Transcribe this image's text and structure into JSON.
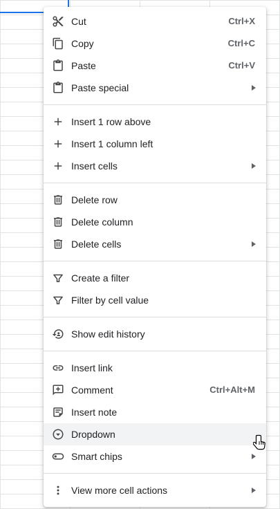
{
  "menu": {
    "groups": [
      [
        {
          "label": "Cut",
          "shortcut": "Ctrl+X",
          "icon": "scissors-icon"
        },
        {
          "label": "Copy",
          "shortcut": "Ctrl+C",
          "icon": "copy-icon"
        },
        {
          "label": "Paste",
          "shortcut": "Ctrl+V",
          "icon": "clipboard-icon"
        },
        {
          "label": "Paste special",
          "icon": "clipboard-icon",
          "submenu": true
        }
      ],
      [
        {
          "label": "Insert 1 row above",
          "icon": "plus-icon"
        },
        {
          "label": "Insert 1 column left",
          "icon": "plus-icon"
        },
        {
          "label": "Insert cells",
          "icon": "plus-icon",
          "submenu": true
        }
      ],
      [
        {
          "label": "Delete row",
          "icon": "trash-icon"
        },
        {
          "label": "Delete column",
          "icon": "trash-icon"
        },
        {
          "label": "Delete cells",
          "icon": "trash-icon",
          "submenu": true
        }
      ],
      [
        {
          "label": "Create a filter",
          "icon": "filter-icon"
        },
        {
          "label": "Filter by cell value",
          "icon": "filter-icon"
        }
      ],
      [
        {
          "label": "Show edit history",
          "icon": "history-icon"
        }
      ],
      [
        {
          "label": "Insert link",
          "icon": "link-icon"
        },
        {
          "label": "Comment",
          "shortcut": "Ctrl+Alt+M",
          "icon": "add-comment-icon"
        },
        {
          "label": "Insert note",
          "icon": "note-icon"
        },
        {
          "label": "Dropdown",
          "icon": "dropdown-circle-icon",
          "hovered": true
        },
        {
          "label": "Smart chips",
          "icon": "smart-chips-icon",
          "submenu": true
        }
      ],
      [
        {
          "label": "View more cell actions",
          "icon": "more-vert-icon",
          "submenu": true
        }
      ]
    ]
  },
  "colors": {
    "icon": "#444746",
    "text": "#202124",
    "shortcut": "#5f6368",
    "hover_bg": "#f1f3f4",
    "selection": "#1a73e8"
  }
}
